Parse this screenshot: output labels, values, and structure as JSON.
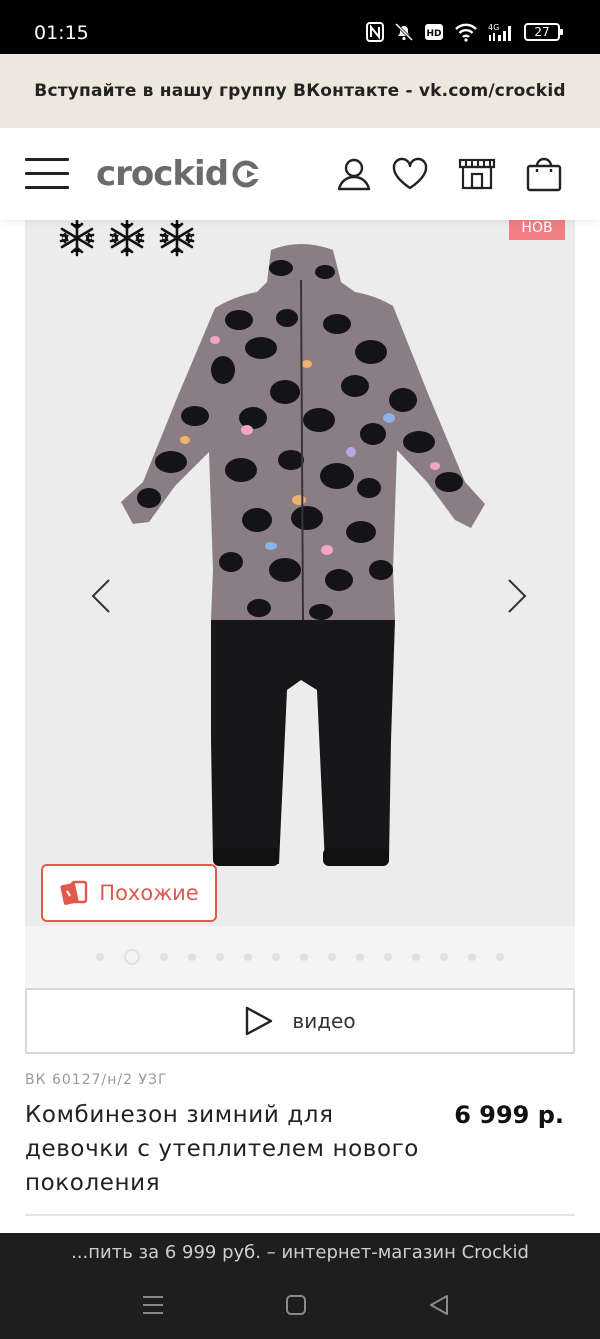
{
  "status_bar": {
    "time": "01:15",
    "battery": "27",
    "icons": [
      "nfc-icon",
      "mute-icon",
      "hd-icon",
      "wifi-icon",
      "signal-4g-icon",
      "battery-icon"
    ]
  },
  "promo": {
    "text": "Вступайте в нашу группу ВКонтакте - vk.com/crockid"
  },
  "header": {
    "logo_text": "crockid",
    "icons": [
      "menu-icon",
      "account-icon",
      "favorites-icon",
      "store-icon",
      "cart-icon"
    ]
  },
  "gallery": {
    "badge_text": "НОВ",
    "similar_label": "Похожие",
    "dot_count": 15,
    "active_dot": 1,
    "garment_colors": {
      "top": "#8b7d84",
      "bottom": "#17171a",
      "spots": "#141416"
    }
  },
  "video_button": {
    "label": "видео"
  },
  "product": {
    "sku": "ВК 60127/н/2 УЗГ",
    "title": "Комбинезон зимний для девочки с утеплителем нового поколения",
    "price": "6 999 р."
  },
  "browser": {
    "url_text": "...пить за 6 999 руб. – интернет-магазин Crockid"
  },
  "colors": {
    "promo_bg": "#ede7dd",
    "accent": "#e1594c",
    "badge": "#f07e84"
  }
}
